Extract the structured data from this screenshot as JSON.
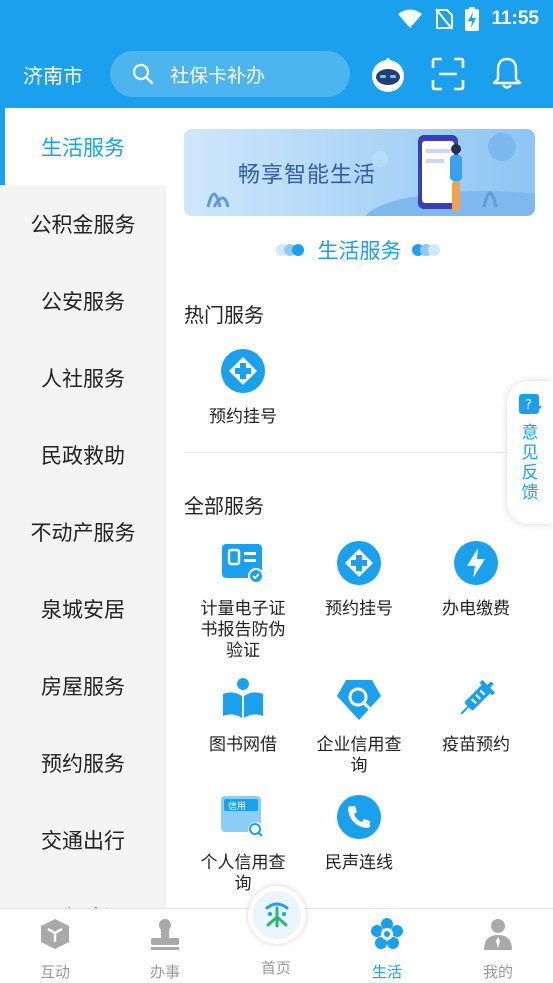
{
  "status_bar": {
    "time": "11:55"
  },
  "header": {
    "city": "济南市",
    "search_placeholder": "社保卡补办"
  },
  "sidebar": {
    "items": [
      {
        "label": "生活服务",
        "active": true
      },
      {
        "label": "公积金服务"
      },
      {
        "label": "公安服务"
      },
      {
        "label": "人社服务"
      },
      {
        "label": "民政救助"
      },
      {
        "label": "不动产服务"
      },
      {
        "label": "泉城安居"
      },
      {
        "label": "房屋服务"
      },
      {
        "label": "预约服务"
      },
      {
        "label": "交通出行"
      },
      {
        "label": "工程建设"
      }
    ]
  },
  "banner": {
    "text": "畅享智能生活"
  },
  "section": {
    "title": "生活服务"
  },
  "hot": {
    "title": "热门服务",
    "items": [
      {
        "label": "预约挂号",
        "icon": "hospital-plus-icon"
      }
    ]
  },
  "all": {
    "title": "全部服务",
    "items": [
      {
        "label": "计量电子证书报告防伪验证",
        "icon": "certificate-icon"
      },
      {
        "label": "预约挂号",
        "icon": "hospital-plus-icon"
      },
      {
        "label": "办电缴费",
        "icon": "lightning-icon"
      },
      {
        "label": "图书网借",
        "icon": "book-icon"
      },
      {
        "label": "企业信用查询",
        "icon": "diamond-search-icon"
      },
      {
        "label": "疫苗预约",
        "icon": "syringe-icon"
      },
      {
        "label": "个人信用查询",
        "icon": "credit-card-icon"
      },
      {
        "label": "民声连线",
        "icon": "phone-icon"
      }
    ]
  },
  "feedback": {
    "label": "意见反馈"
  },
  "bottom_nav": {
    "items": [
      {
        "label": "互动"
      },
      {
        "label": "办事"
      },
      {
        "label": "首页"
      },
      {
        "label": "生活",
        "active": true
      },
      {
        "label": "我的"
      }
    ]
  },
  "colors": {
    "accent": "#1aa0ec",
    "inactive": "#999999",
    "sidebar_bg": "#f4f4f4"
  }
}
